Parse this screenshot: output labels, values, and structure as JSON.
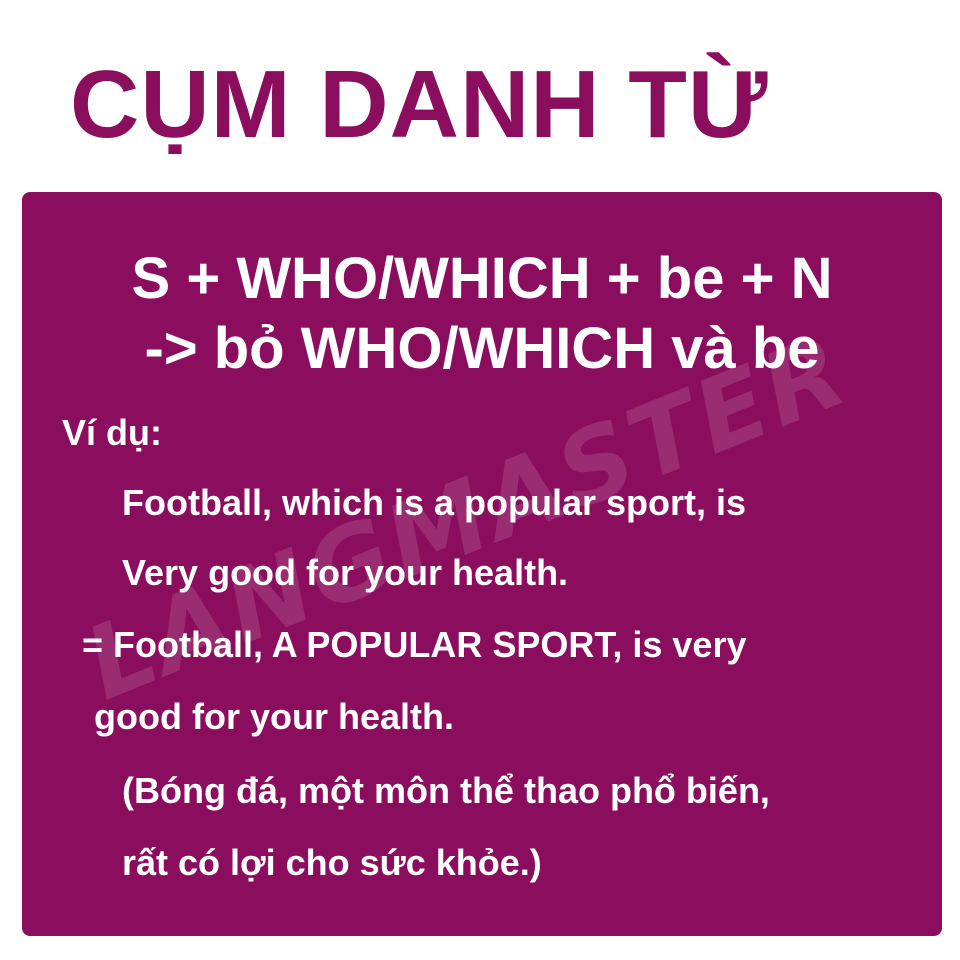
{
  "title": "CỤM DANH TỪ",
  "watermark": "LANGMASTER",
  "formula": {
    "line1": "S + WHO/WHICH + be + N",
    "line2": "-> bỏ WHO/WHICH và be"
  },
  "example": {
    "label": "Ví dụ:",
    "sentence_line1": "Football, which is a popular sport, is",
    "sentence_line2": "Very good for your health.",
    "result_line1": "= Football, A POPULAR SPORT, is very",
    "result_line2": "good for your health.",
    "translation_line1": "(Bóng đá, một môn thể thao phổ biến,",
    "translation_line2": "rất có lợi cho sức khỏe.)"
  },
  "colors": {
    "brand": "#8b0e5e",
    "text_on_card": "#ffffff",
    "background": "#ffffff"
  }
}
